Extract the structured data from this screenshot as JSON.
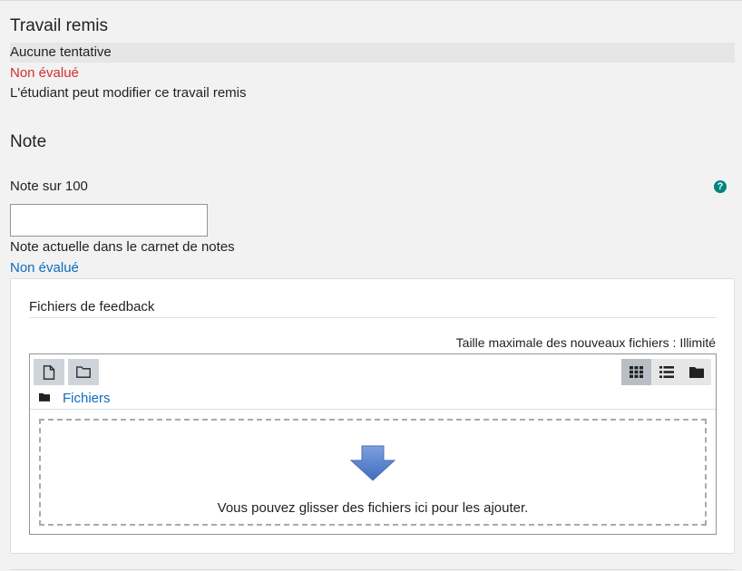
{
  "submission": {
    "heading": "Travail remis",
    "attempt_status": "Aucune tentative",
    "grading_status": "Non évalué",
    "edit_status": "L'étudiant peut modifier ce travail remis"
  },
  "grade": {
    "heading": "Note",
    "label": "Note sur 100",
    "help_icon": "question-icon",
    "input_value": "",
    "current_label": "Note actuelle dans le carnet de notes",
    "current_value": "Non évalué"
  },
  "feedback_files": {
    "title": "Fichiers de feedback",
    "max_size": "Taille maximale des nouveaux fichiers : Illimité",
    "toolbar": {
      "add_file_icon": "file-icon",
      "create_folder_icon": "folder-outline-icon",
      "views": [
        "grid-icon",
        "list-icon",
        "folder-icon"
      ],
      "active_view": "grid-icon"
    },
    "path_label": "Fichiers",
    "drop_text": "Vous pouvez glisser des fichiers ici pour les ajouter."
  },
  "colors": {
    "red": "#d32f2f",
    "link_blue": "#0f6cbf",
    "help_teal": "#00857f",
    "arrow_blue": "#4a77c8"
  }
}
